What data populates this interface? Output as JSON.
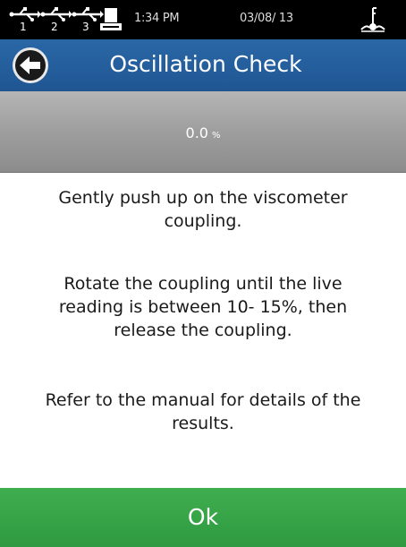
{
  "status_bar": {
    "usb_ports": [
      "1",
      "2",
      "3"
    ],
    "icons": [
      "usb-icon",
      "printer-icon",
      "level-icon"
    ],
    "time": "1:34 PM",
    "date": "03/08/ 13"
  },
  "header": {
    "title": "Oscillation Check",
    "back_icon": "back-arrow-icon",
    "color": "#2463a0"
  },
  "reading": {
    "value": "0.0",
    "unit": "%"
  },
  "instructions": [
    "Gently push up on the viscometer coupling.",
    "Rotate the coupling until the live reading is between 10- 15%, then release the coupling.",
    "Refer to the manual for details of the results."
  ],
  "ok_button": {
    "label": "Ok",
    "color": "#35a347"
  }
}
